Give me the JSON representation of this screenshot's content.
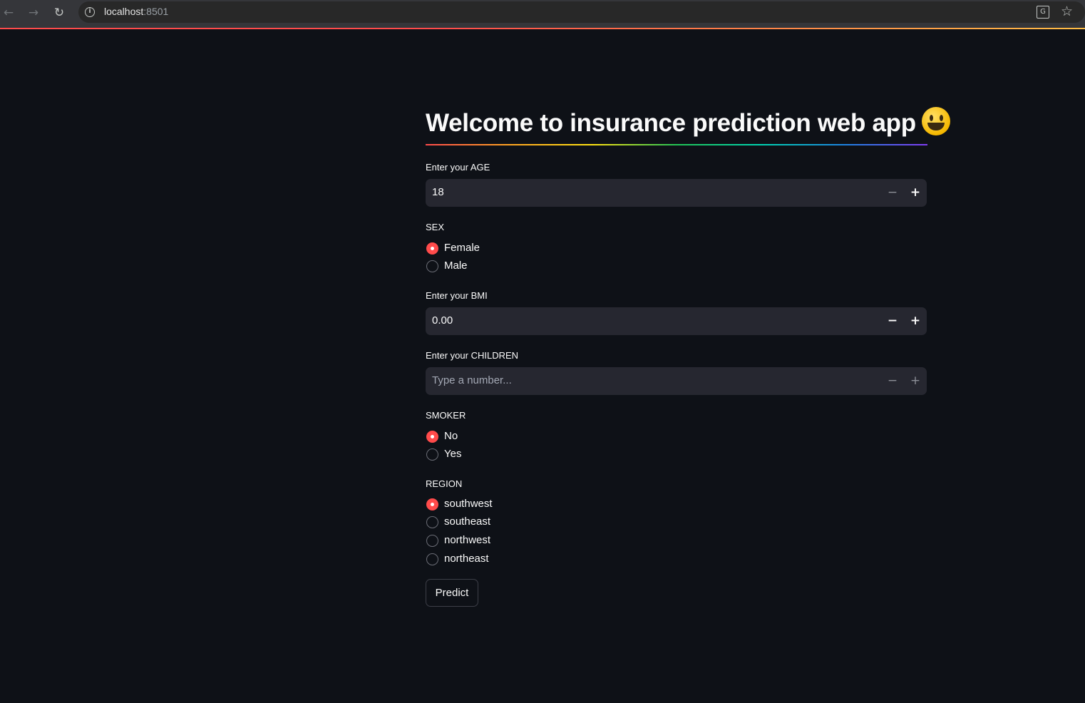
{
  "browser": {
    "url_host": "localhost",
    "url_port": ":8501",
    "back_icon": "arrow-left-icon",
    "forward_icon": "arrow-right-icon",
    "reload_icon": "reload-icon",
    "info_icon": "info-icon",
    "translate_icon": "translate-icon",
    "bookmark_icon": "star-icon"
  },
  "app": {
    "title": "Welcome to insurance prediction web app",
    "age": {
      "label": "Enter your AGE",
      "value": "18"
    },
    "sex": {
      "label": "SEX",
      "options": [
        "Female",
        "Male"
      ],
      "selected": "Female"
    },
    "bmi": {
      "label": "Enter your BMI",
      "value": "0.00"
    },
    "children": {
      "label": "Enter your CHILDREN",
      "placeholder": "Type a number..."
    },
    "smoker": {
      "label": "SMOKER",
      "options": [
        "No",
        "Yes"
      ],
      "selected": "No"
    },
    "region": {
      "label": "REGION",
      "options": [
        "southwest",
        "southeast",
        "northwest",
        "northeast"
      ],
      "selected": "southwest"
    },
    "predict_label": "Predict",
    "stepper_minus": "−",
    "stepper_plus": "+"
  },
  "colors": {
    "background": "#0e1117",
    "input_bg": "#262730",
    "accent": "#ff4b4b"
  }
}
